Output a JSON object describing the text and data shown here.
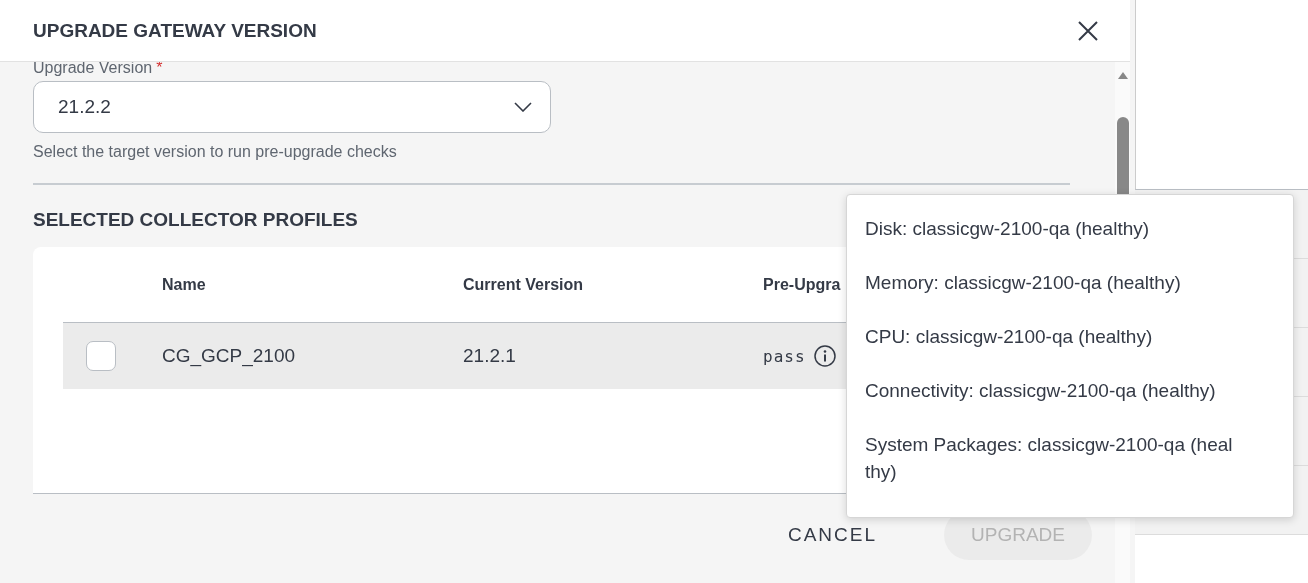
{
  "dialog": {
    "title": "UPGRADE GATEWAY VERSION"
  },
  "version_field": {
    "label": "Upgrade Version",
    "required_mark": "*",
    "value": "21.2.2",
    "hint": "Select the target version to run pre-upgrade checks"
  },
  "section_title": "SELECTED COLLECTOR PROFILES",
  "table": {
    "columns": [
      "Name",
      "Current Version",
      "Pre-Upgra"
    ],
    "rows": [
      {
        "checked": false,
        "name": "CG_GCP_2100",
        "version": "21.2.1",
        "status": "pass"
      }
    ]
  },
  "popover": {
    "items": [
      "Disk: classicgw-2100-qa (healthy)",
      "Memory: classicgw-2100-qa (healthy)",
      "CPU: classicgw-2100-qa (healthy)",
      "Connectivity: classicgw-2100-qa (healthy)",
      "System Packages: classicgw-2100-qa (healthy)"
    ]
  },
  "buttons": [
    {
      "label": "CANCEL",
      "kind": "text",
      "disabled": false
    },
    {
      "label": "UPGRADE",
      "kind": "filled",
      "disabled": true
    }
  ]
}
